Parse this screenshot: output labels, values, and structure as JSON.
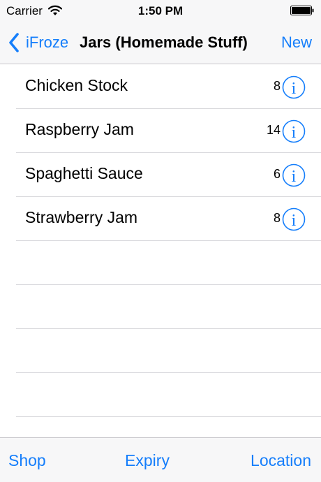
{
  "status": {
    "carrier": "Carrier",
    "time": "1:50 PM"
  },
  "nav": {
    "back_label": "iFroze",
    "title": "Jars (Homemade Stuff)",
    "new_label": "New"
  },
  "items": [
    {
      "name": "Chicken Stock",
      "count": "8"
    },
    {
      "name": "Raspberry Jam",
      "count": "14"
    },
    {
      "name": "Spaghetti Sauce",
      "count": "6"
    },
    {
      "name": "Strawberry Jam",
      "count": "8"
    }
  ],
  "toolbar": {
    "shop": "Shop",
    "expiry": "Expiry",
    "location": "Location"
  },
  "colors": {
    "accent": "#157efb",
    "bar_background": "#f7f7f8",
    "separator": "#d8d8dc"
  },
  "icons": {
    "back": "chevron-left-icon",
    "info": "info-circle-icon",
    "wifi": "wifi-icon",
    "battery": "battery-icon"
  }
}
